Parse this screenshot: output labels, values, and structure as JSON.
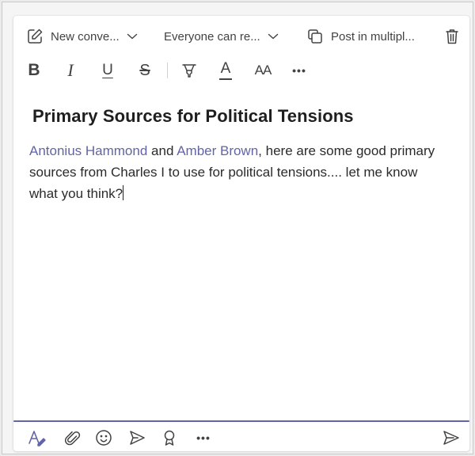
{
  "header": {
    "new_conversation": {
      "label": "New conve...",
      "icon": "edit-icon"
    },
    "audience": {
      "label": "Everyone can re..."
    },
    "post_multiple": {
      "label": "Post in multipl...",
      "icon": "copy-icon"
    },
    "delete": {
      "icon": "trash-icon"
    }
  },
  "toolbar": {
    "bold": "B",
    "italic": "I",
    "underline": "U",
    "strikethrough": "S",
    "highlight_icon": "highlighter-icon",
    "font_color": "A",
    "font_size": "AA",
    "more": "•••"
  },
  "message": {
    "subject": "Primary Sources for Political Tensions",
    "mention_1": "Antonius Hammond",
    "text_1": " and ",
    "mention_2": "Amber Brown",
    "text_2": ", here are some good primary sources from Charles I to use for political tensions.... let me know what you think?"
  },
  "bottom_bar": {
    "format_icon": "format-icon",
    "attach_icon": "paperclip-icon",
    "emoji_icon": "emoji-icon",
    "gif_icon": "gif-icon",
    "praise_icon": "praise-badge-icon",
    "more": "•••",
    "send_icon": "send-icon"
  },
  "colors": {
    "accent": "#6264a7",
    "mention": "#6264a7",
    "text": "#242424",
    "background": "#ffffff"
  }
}
